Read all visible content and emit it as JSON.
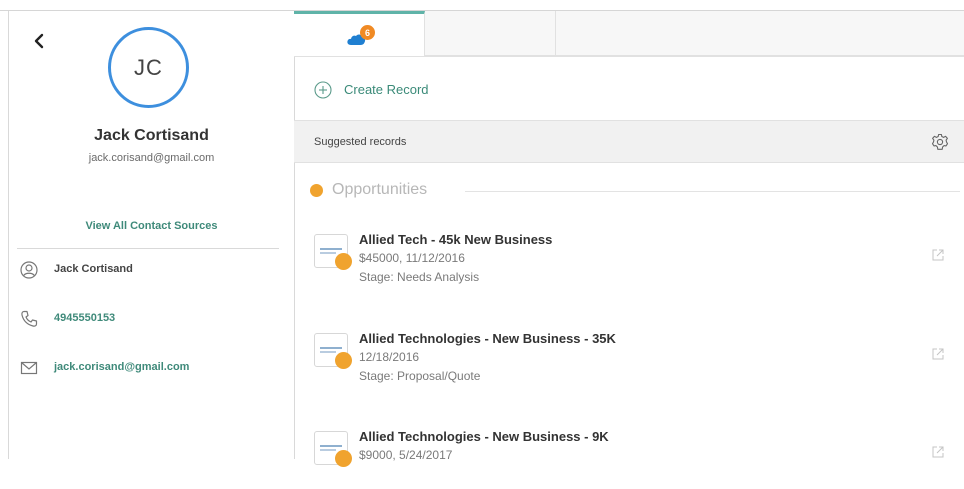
{
  "contact": {
    "initials": "JC",
    "name": "Jack Cortisand",
    "email": "jack.corisand@gmail.com",
    "view_all_label": "View All Contact Sources"
  },
  "details": [
    {
      "icon": "person-icon",
      "value": "Jack Cortisand"
    },
    {
      "icon": "phone-icon",
      "value": "4945550153"
    },
    {
      "icon": "mail-icon",
      "value": "jack.corisand@gmail.com"
    }
  ],
  "tabs": {
    "salesforce_badge": "6",
    "salesforce_icon": "cloud-icon",
    "tasks_icon": "clipboard-icon"
  },
  "create_record_label": "Create Record",
  "suggested_label": "Suggested records",
  "section_title": "Opportunities",
  "records": [
    {
      "title": "Allied Tech - 45k New Business",
      "meta1": "$45000, 11/12/2016",
      "meta2": "Stage: Needs Analysis"
    },
    {
      "title": "Allied Technologies - New Business - 35K",
      "meta1": "12/18/2016",
      "meta2": "Stage: Proposal/Quote"
    },
    {
      "title": "Allied Technologies - New Business - 9K",
      "meta1": "$9000, 5/24/2017",
      "meta2": ""
    }
  ],
  "colors": {
    "accent": "#3a8a78",
    "avatar_ring": "#3d8fde",
    "badge": "#f08a24",
    "crown": "#f0a32e",
    "tab_active": "#5fb3a8"
  }
}
